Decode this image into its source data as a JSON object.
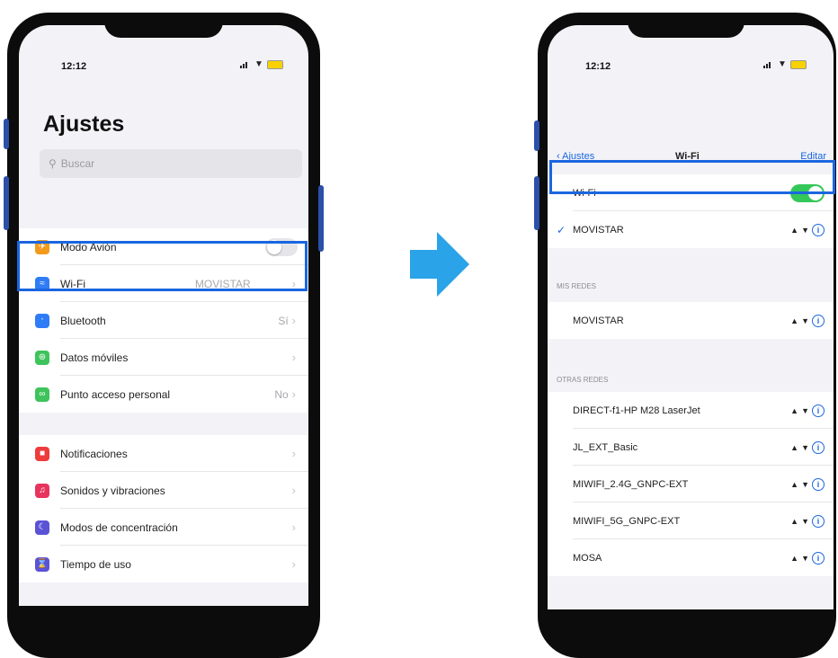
{
  "left": {
    "time": "12:12",
    "title": "Ajustes",
    "search_placeholder": "Buscar",
    "group1": [
      {
        "label": "Modo Avión",
        "value": "",
        "icon": "airplane-icon",
        "color": "#f29a1c"
      },
      {
        "label": "Wi-Fi",
        "value": "MOVISTAR",
        "icon": "wifi-icon",
        "color": "#2f7cf6"
      },
      {
        "label": "Bluetooth",
        "value": "Sí",
        "icon": "bluetooth-icon",
        "color": "#2f7cf6"
      },
      {
        "label": "Datos móviles",
        "value": "",
        "icon": "antenna-icon",
        "color": "#3ec45b"
      },
      {
        "label": "Punto acceso personal",
        "value": "No",
        "icon": "hotspot-icon",
        "color": "#3ec45b"
      }
    ],
    "group2": [
      {
        "label": "Notificaciones",
        "icon": "notifications-icon",
        "color": "#ee3b3b"
      },
      {
        "label": "Sonidos y vibraciones",
        "icon": "sound-icon",
        "color": "#e8335d"
      },
      {
        "label": "Modos de concentración",
        "icon": "moon-icon",
        "color": "#5b53d6"
      },
      {
        "label": "Tiempo de uso",
        "icon": "hourglass-icon",
        "color": "#5b53d6"
      }
    ]
  },
  "right": {
    "time": "12:12",
    "nav": {
      "back": "Ajustes",
      "title": "Wi-Fi",
      "edit": "Editar"
    },
    "wifi_label": "Wi-Fi",
    "connected": "MOVISTAR",
    "my_networks_header": "MIS REDES",
    "my_networks": [
      "MOVISTAR"
    ],
    "other_networks_header": "OTRAS REDES",
    "other_networks": [
      "DIRECT-f1-HP M28 LaserJet",
      "JL_EXT_Basic",
      "MIWIFI_2.4G_GNPC-EXT",
      "MIWIFI_5G_GNPC-EXT",
      "MOSA"
    ]
  },
  "colors": {
    "accent": "#1b66e0",
    "toggle_on": "#34c759"
  }
}
